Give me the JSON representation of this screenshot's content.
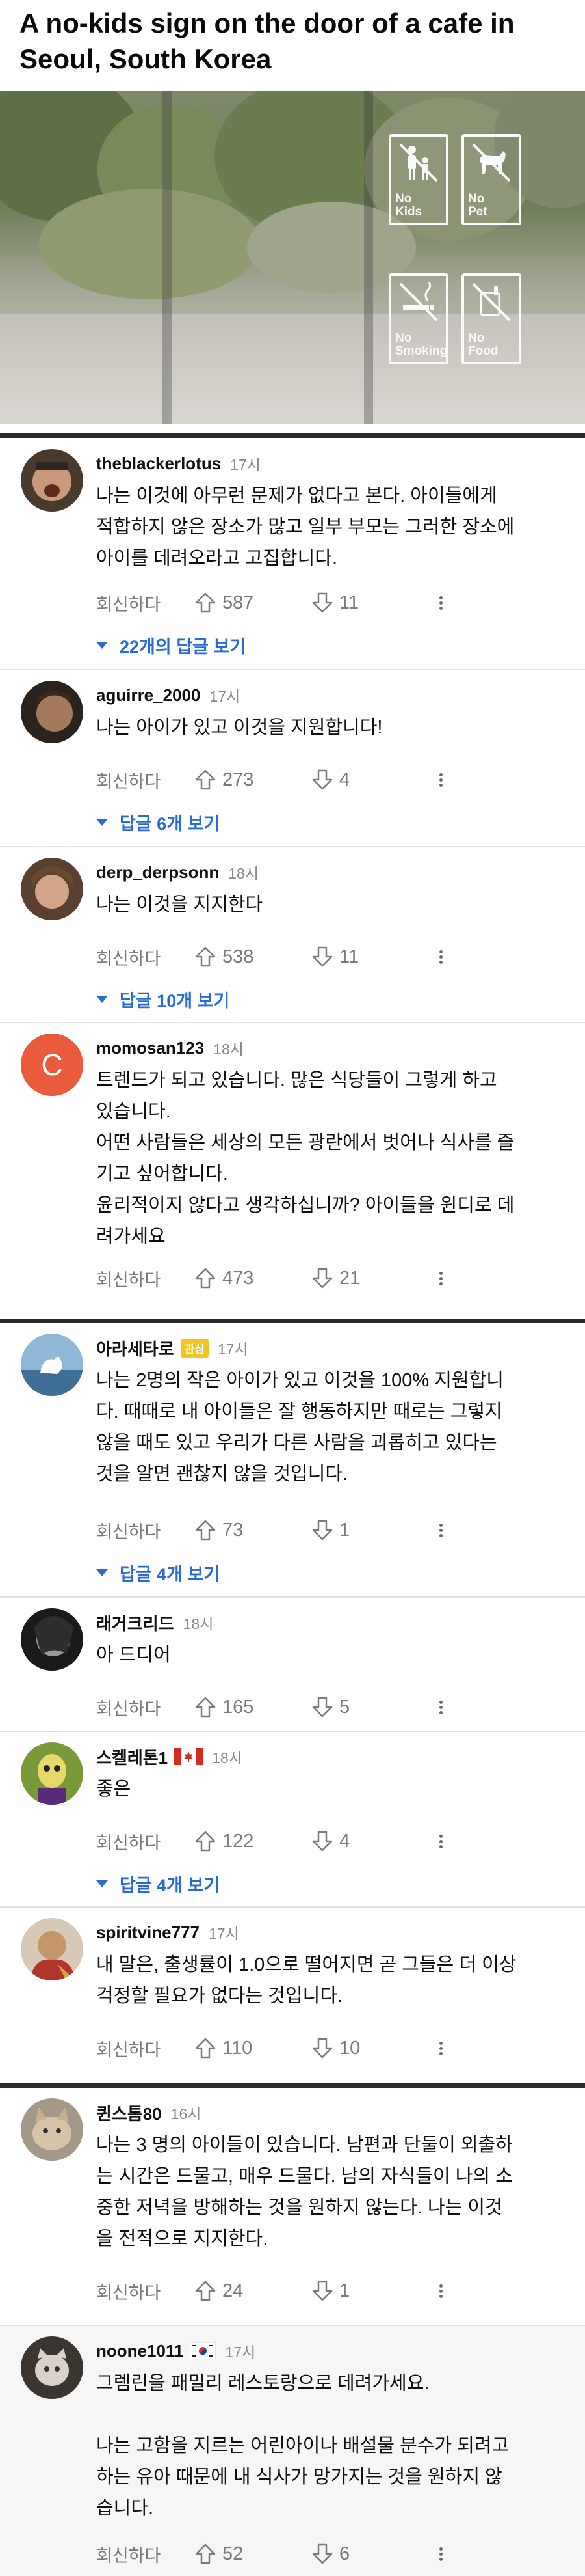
{
  "post": {
    "title": "A no-kids sign on the door of a cafe in Seoul, South Korea",
    "signs": [
      {
        "icon": "no-kids-icon",
        "label_line1": "No",
        "label_line2": "Kids"
      },
      {
        "icon": "no-pet-icon",
        "label_line1": "No",
        "label_line2": "Pet"
      },
      {
        "icon": "no-smoking-icon",
        "label_line1": "No",
        "label_line2": "Smoking"
      },
      {
        "icon": "no-food-icon",
        "label_line1": "No",
        "label_line2": "Food"
      }
    ]
  },
  "ui": {
    "reply_label": "회신하다"
  },
  "comments": [
    {
      "user": "theblackerlotus",
      "time": "17시",
      "lines": [
        "나는 이것에 아무런 문제가 없다고 본다. 아이들에게",
        "적합하지 않은 장소가 많고 일부 부모는 그러한 장소에",
        "아이를 데려오라고 고집합니다."
      ],
      "up": "587",
      "down": "11",
      "replies": "22개의 답글 보기"
    },
    {
      "user": "aguirre_2000",
      "time": "17시",
      "lines": [
        "나는 아이가 있고 이것을 지원합니다!"
      ],
      "up": "273",
      "down": "4",
      "replies": "답글 6개 보기"
    },
    {
      "user": "derp_derpsonn",
      "time": "18시",
      "lines": [
        "나는 이것을 지지한다"
      ],
      "up": "538",
      "down": "11",
      "replies": "답글 10개 보기"
    },
    {
      "user": "momosan123",
      "time": "18시",
      "avatar_letter": "C",
      "lines": [
        "트렌드가 되고 있습니다. 많은 식당들이 그렇게 하고",
        "있습니다.",
        "어떤 사람들은 세상의 모든 광란에서 벗어나 식사를 즐",
        "기고 싶어합니다.",
        "윤리적이지 않다고 생각하십니까? 아이들을 윈디로 데",
        "려가세요"
      ],
      "up": "473",
      "down": "21"
    },
    {
      "user": "아라세타로",
      "time": "17시",
      "badge": "관심",
      "lines": [
        "나는 2명의 작은 아이가 있고 이것을 100% 지원합니",
        "다. 때때로 내 아이들은 잘 행동하지만 때로는 그렇지",
        "않을 때도 있고 우리가 다른 사람을 괴롭히고 있다는",
        "것을 알면 괜찮지 않을 것입니다."
      ],
      "up": "73",
      "down": "1",
      "replies": "답글 4개 보기"
    },
    {
      "user": "래거크리드",
      "time": "18시",
      "lines": [
        "아 드디어"
      ],
      "up": "165",
      "down": "5"
    },
    {
      "user": "스켈레톤1",
      "time": "18시",
      "lines": [
        "좋은"
      ],
      "up": "122",
      "down": "4",
      "replies": "답글 4개 보기"
    },
    {
      "user": "spiritvine777",
      "time": "17시",
      "lines": [
        "내 말은, 출생률이 1.0으로 떨어지면 곧 그들은 더 이상",
        "걱정할 필요가 없다는 것입니다."
      ],
      "up": "110",
      "down": "10"
    },
    {
      "user": "퀸스톰80",
      "time": "16시",
      "lines": [
        "나는 3 명의 아이들이 있습니다. 남편과 단둘이 외출하",
        "는 시간은 드물고, 매우 드물다. 남의 자식들이 나의 소",
        "중한 저녁을 방해하는 것을 원하지 않는다. 나는 이것",
        "을 전적으로 지지한다."
      ],
      "up": "24",
      "down": "1"
    },
    {
      "user": "noone1011",
      "time": "17시",
      "lines": [
        "그렘린을 패밀리 레스토랑으로 데려가세요.",
        "",
        "나는 고함을 지르는 어린아이나 배설물 분수가 되려고",
        "하는 유아 때문에 내 식사가 망가지는 것을 원하지 않",
        "습니다."
      ],
      "up": "52",
      "down": "6"
    }
  ]
}
